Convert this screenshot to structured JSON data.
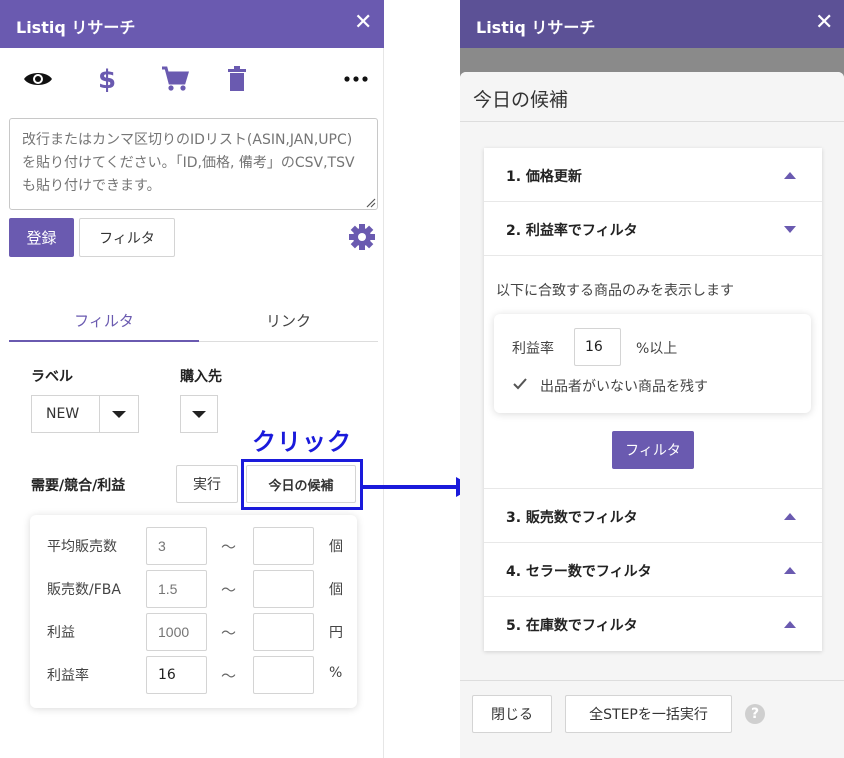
{
  "left": {
    "app_title": "Listiq リサーチ",
    "close_glyph": "✕",
    "toolbar_icons": [
      "eye-icon",
      "dollar-icon",
      "cart-icon",
      "trash-icon",
      "more-icon"
    ],
    "id_input_placeholder": "改行またはカンマ区切りのIDリスト(ASIN,JAN,UPC)を貼り付けてください。「ID,価格, 備考」のCSV,TSVも貼り付けできます。",
    "register_label": "登録",
    "filter_button_label": "フィルタ",
    "tabs": [
      {
        "label": "フィルタ",
        "active": true
      },
      {
        "label": "リンク",
        "active": false
      }
    ],
    "label_heading": "ラベル",
    "label_select_value": "NEW",
    "source_heading": "購入先",
    "demand_heading": "需要/競合/利益",
    "run_label": "実行",
    "today_candidates_label": "今日の候補",
    "ranges": [
      {
        "label": "平均販売数",
        "min_placeholder": "3",
        "min_value": "",
        "max_value": "",
        "unit": "個"
      },
      {
        "label": "販売数/FBA",
        "min_placeholder": "1.5",
        "min_value": "",
        "max_value": "",
        "unit": "個"
      },
      {
        "label": "利益",
        "min_placeholder": "1000",
        "min_value": "",
        "max_value": "",
        "unit": "円"
      },
      {
        "label": "利益率",
        "min_placeholder": "",
        "min_value": "16",
        "max_value": "",
        "unit": "%"
      }
    ],
    "tilde": "〜"
  },
  "annotation": {
    "label": "クリック",
    "color": "#1a1adb"
  },
  "right": {
    "app_title": "Listiq リサーチ",
    "close_glyph": "✕",
    "dialog_title": "今日の候補",
    "steps": [
      {
        "title": "1. 価格更新",
        "expanded": false
      },
      {
        "title": "2. 利益率でフィルタ",
        "expanded": true
      },
      {
        "title": "3. 販売数でフィルタ",
        "expanded": false
      },
      {
        "title": "4. セラー数でフィルタ",
        "expanded": false
      },
      {
        "title": "5. 在庫数でフィルタ",
        "expanded": false
      }
    ],
    "step2": {
      "description": "以下に合致する商品のみを表示します",
      "margin_label": "利益率",
      "margin_value": "16",
      "margin_suffix": "%以上",
      "keep_no_seller_label": "出品者がいない商品を残す",
      "keep_no_seller_checked": true,
      "filter_button_label": "フィルタ"
    },
    "close_label": "閉じる",
    "run_all_label": "全STEPを一括実行",
    "help_glyph": "?"
  },
  "colors": {
    "brand": "#6a5ab0",
    "annotation": "#1a1adb"
  }
}
